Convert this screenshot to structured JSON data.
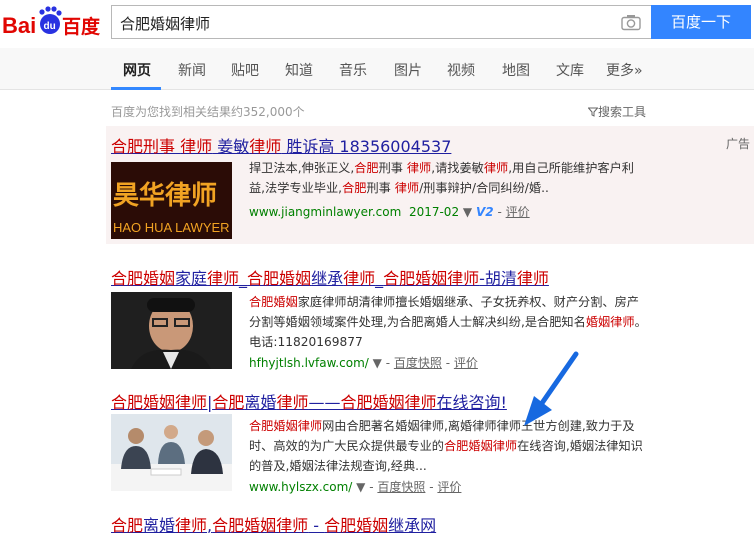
{
  "header": {
    "logo_text": "Bai百度",
    "query": "合肥婚姻律师",
    "search_button": "百度一下"
  },
  "nav": {
    "tabs": [
      "网页",
      "新闻",
      "贴吧",
      "知道",
      "音乐",
      "图片",
      "视频",
      "地图",
      "文库",
      "更多»"
    ]
  },
  "result_count": "百度为您找到相关结果约352,000个",
  "tools_label": "搜索工具",
  "ad_label": "广告",
  "results": [
    {
      "title_parts": [
        "合肥刑事 律师 姜敏律师 胜诉高 18356004537"
      ],
      "thumb_text_top": "昊华律师",
      "thumb_text_bottom": "HAO HUA LAWYER",
      "abstract": "捍卫法本,伸张正义,合肥刑事 律师,请找姜敏律师,用自己所能维护客户利益,法学专业毕业,合肥刑事 律师/刑事辩护/合同纠纷/婚..",
      "url": "www.jiangminlawyer.com",
      "date": "2017-02",
      "badge": "V2",
      "link": "评价"
    },
    {
      "title": "合肥婚姻家庭律师_合肥婚姻继承律师_合肥婚姻律师-胡清律师",
      "abstract": "合肥婚姻家庭律师胡清律师擅长婚姻继承、子女抚养权、财产分割、房产分割等婚姻领域案件处理,为合肥离婚人士解决纠纷,是合肥知名婚姻律师。电话:11820169877",
      "url": "hfhyjtlsh.lvfaw.com/",
      "snapshot": "百度快照",
      "link": "评价"
    },
    {
      "title": "合肥婚姻律师|合肥离婚律师——合肥婚姻律师在线咨询!",
      "abstract": "合肥婚姻律师网由合肥著名婚姻律师,离婚律师律师王世方创建,致力于及时、高效的为广大民众提供最专业的合肥婚姻律师在线咨询,婚姻法律知识的普及,婚姻法律法规查询,经典...",
      "url": "www.hylszx.com/",
      "snapshot": "百度快照",
      "link": "评价"
    },
    {
      "title": "合肥离婚律师,合肥婚姻律师 - 合肥婚姻继承网"
    }
  ],
  "colors": {
    "accent": "#3385ff",
    "title_link": "#2020a0",
    "highlight": "#cc0000",
    "url_green": "#008000",
    "arrow": "#1769e0"
  }
}
